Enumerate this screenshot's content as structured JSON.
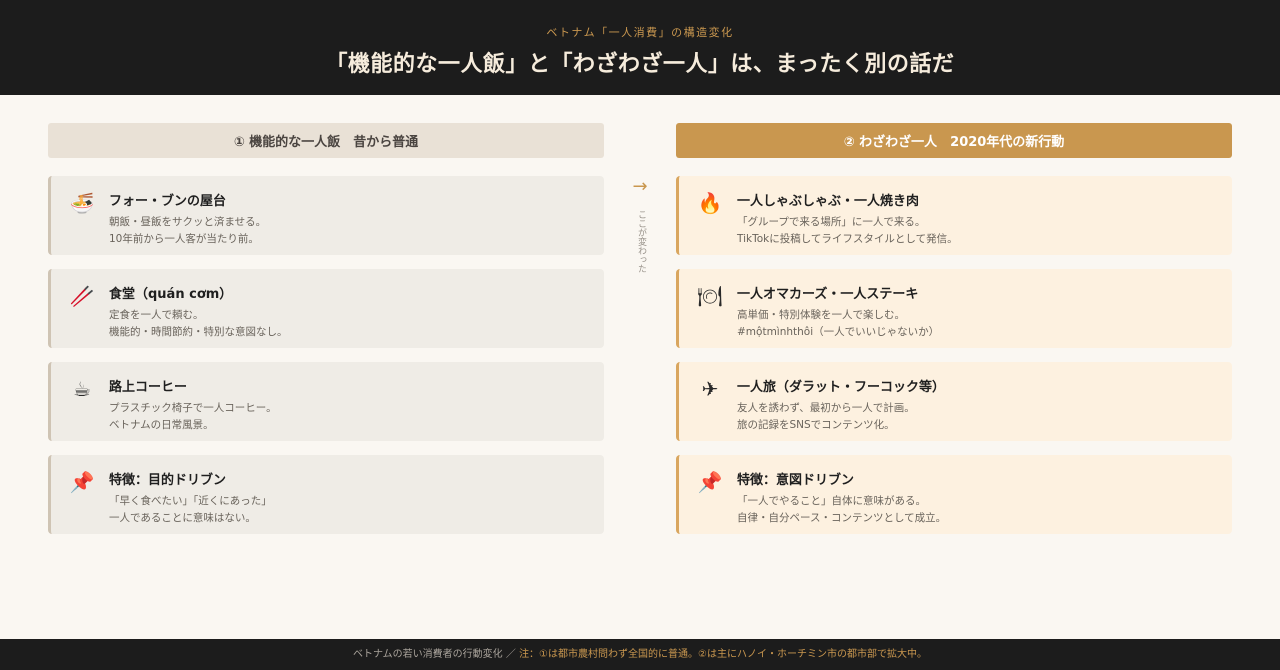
{
  "header": {
    "kicker": "ベトナム「一人消費」の構造変化",
    "title": "「機能的な一人飯」と「わざわざ一人」は、まったく別の話だ"
  },
  "left": {
    "heading": "① 機能的な一人飯　昔から普通",
    "cards": [
      {
        "icon": "noodle-bowl-icon",
        "glyph": "🍜",
        "title": "フォー・ブンの屋台",
        "line1": "朝飯・昼飯をサクッと済ませる。",
        "line2": "10年前から一人客が当たり前。"
      },
      {
        "icon": "chopsticks-icon",
        "glyph": "🥢",
        "title": "食堂（quán cơm）",
        "line1": "定食を一人で頼む。",
        "line2": "機能的・時間節約・特別な意図なし。"
      },
      {
        "icon": "coffee-cup-icon",
        "glyph": "☕",
        "title": "路上コーヒー",
        "line1": "プラスチック椅子で一人コーヒー。",
        "line2": "ベトナムの日常風景。"
      },
      {
        "icon": "pushpin-icon",
        "glyph": "📌",
        "title": "特徴：目的ドリブン",
        "line1": "「早く食べたい」「近くにあった」",
        "line2": "一人であることに意味はない。"
      }
    ]
  },
  "right": {
    "heading": "② わざわざ一人　2020年代の新行動",
    "cards": [
      {
        "icon": "fire-icon",
        "glyph": "🔥",
        "title": "一人しゃぶしゃぶ・一人焼き肉",
        "line1": "「グループで来る場所」に一人で来る。",
        "line2": "TikTokに投稿してライフスタイルとして発信。"
      },
      {
        "icon": "plate-cutlery-icon",
        "glyph": "🍽",
        "title": "一人オマカーズ・一人ステーキ",
        "line1": "高単価・特別体験を一人で楽しむ。",
        "line2": "#mộtmìnhthôi（一人でいいじゃないか）"
      },
      {
        "icon": "airplane-icon",
        "glyph": "✈",
        "title": "一人旅（ダラット・フーコック等）",
        "line1": "友人を誘わず、最初から一人で計画。",
        "line2": "旅の記録をSNSでコンテンツ化。"
      },
      {
        "icon": "pushpin-icon",
        "glyph": "📌",
        "title": "特徴：意図ドリブン",
        "line1": "「一人でやること」自体に意味がある。",
        "line2": "自律・自分ペース・コンテンツとして成立。"
      }
    ]
  },
  "divider": {
    "arrow": "→",
    "text": "ここが変わった"
  },
  "footer": {
    "text": "ベトナムの若い消費者の行動変化 ／",
    "note": "注：①は都市農村問わず全国的に普通。②は主にハノイ・ホーチミン市の都市部で拡大中。"
  },
  "colors": {
    "accent": "#c9974f",
    "dark": "#1c1c1c",
    "background": "#faf7f2"
  }
}
